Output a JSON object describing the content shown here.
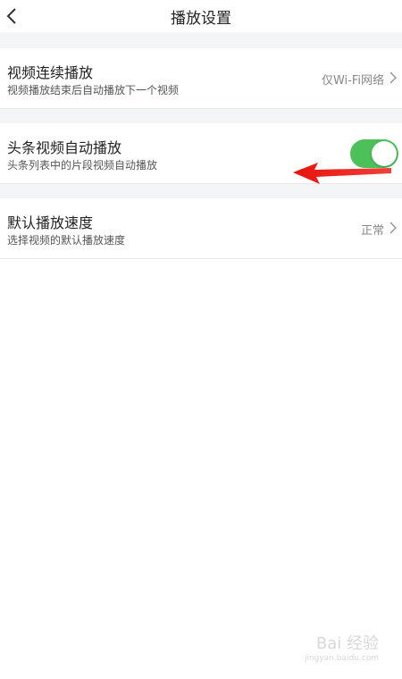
{
  "header": {
    "title": "播放设置",
    "back_icon": "chevron-left-icon"
  },
  "settings": [
    {
      "title": "视频连续播放",
      "subtitle": "视频播放结束后自动播放下一个视频",
      "value": "仅Wi-Fi网络",
      "control": "chevron-right-icon"
    },
    {
      "title": "头条视频自动播放",
      "subtitle": "头条列表中的片段视频自动播放",
      "toggle_on": true,
      "control": "toggle-switch"
    },
    {
      "title": "默认播放速度",
      "subtitle": "选择视频的默认播放速度",
      "value": "正常",
      "control": "chevron-right-icon"
    }
  ],
  "annotation": {
    "icon": "red-arrow-icon",
    "color": "#e8120c"
  },
  "watermark": {
    "brand": "Bai 经验",
    "url": "jingyan.baidu.com"
  },
  "colors": {
    "toggle_on": "#4cc15a",
    "section_gap": "#f4f5f6"
  }
}
